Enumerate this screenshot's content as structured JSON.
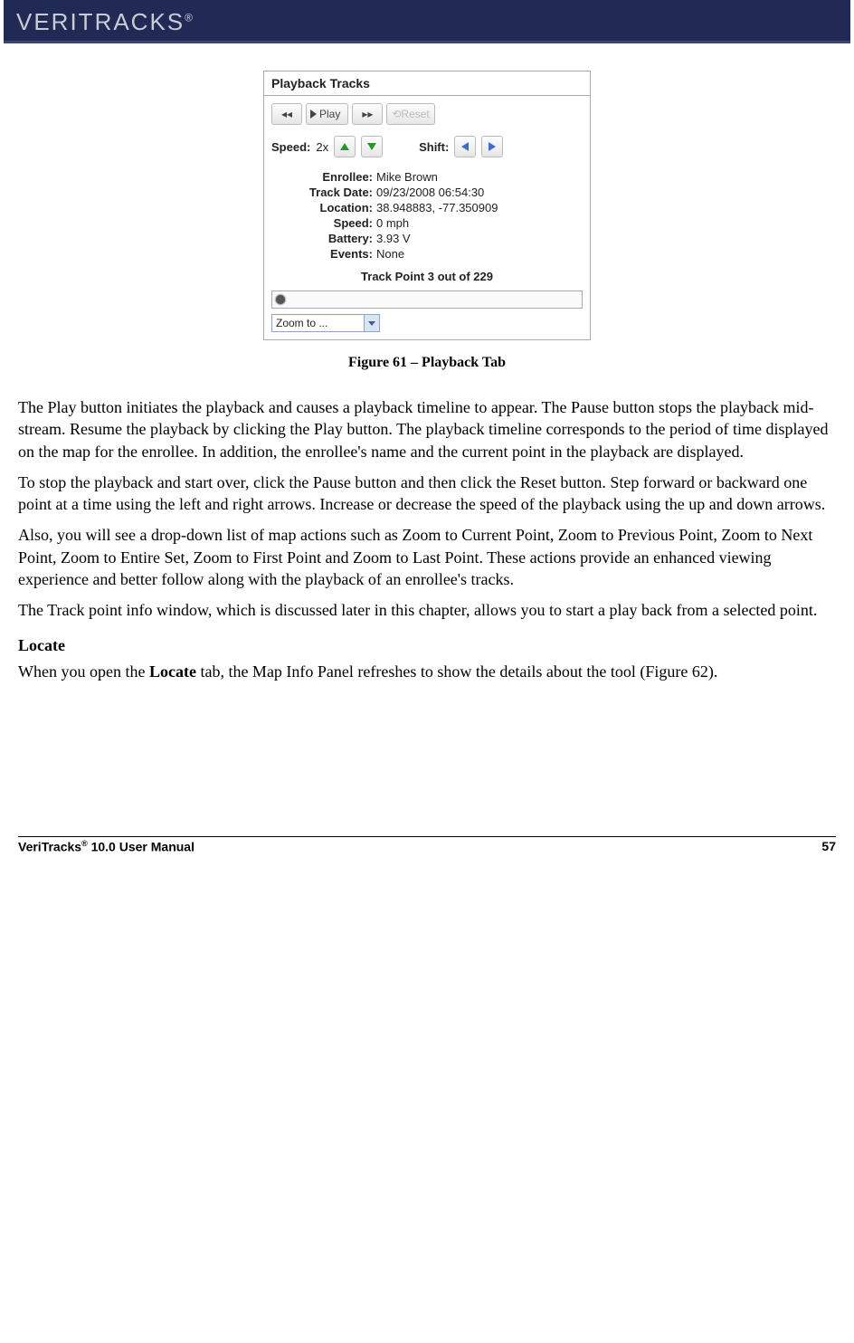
{
  "header": {
    "brand": "VERITRACKS",
    "reg": "®"
  },
  "panel": {
    "title": "Playback Tracks",
    "play_label": "Play",
    "reset_label": "Reset",
    "speed_label": "Speed:",
    "speed_value": "2x",
    "shift_label": "Shift:",
    "fields": {
      "enrollee_lbl": "Enrollee:",
      "enrollee_val": "Mike Brown",
      "trackdate_lbl": "Track Date:",
      "trackdate_val": "09/23/2008 06:54:30",
      "location_lbl": "Location:",
      "location_val": "38.948883, -77.350909",
      "speed_lbl": "Speed:",
      "speed_val": "0 mph",
      "battery_lbl": "Battery:",
      "battery_val": "3.93 V",
      "events_lbl": "Events:",
      "events_val": "None"
    },
    "trackpoint": "Track Point 3 out of 229",
    "zoom_label": "Zoom to ..."
  },
  "caption": "Figure 61 – Playback Tab",
  "body": {
    "p1": "The Play button initiates the playback and causes a playback timeline to appear. The Pause button stops the playback mid-stream. Resume the playback by clicking the Play button. The playback timeline corresponds to the period of time displayed on the map for the enrollee. In addition, the enrollee's name and the current point in the playback are displayed.",
    "p2": "To stop the playback and start over, click the Pause button and then click the Reset button. Step forward or backward one point at a time using the left and right arrows. Increase or decrease the speed of the playback using the up and down arrows.",
    "p3": "Also, you will see a drop-down list of map actions such as Zoom to Current Point, Zoom to Previous Point, Zoom to Next Point, Zoom to Entire Set, Zoom to First Point and Zoom to Last Point. These actions provide an enhanced viewing experience and better follow along with the playback of an enrollee's tracks.",
    "p4": "The Track point info window, which is discussed later in this chapter, allows you to start a play back from a selected point.",
    "locate_h": "Locate",
    "locate_p_a": "When you open the ",
    "locate_p_b": "Locate",
    "locate_p_c": " tab, the Map Info Panel refreshes to show the details about the tool (Figure 62)."
  },
  "footer": {
    "left_a": "VeriTracks",
    "left_b": " 10.0 User Manual",
    "right": "57"
  }
}
